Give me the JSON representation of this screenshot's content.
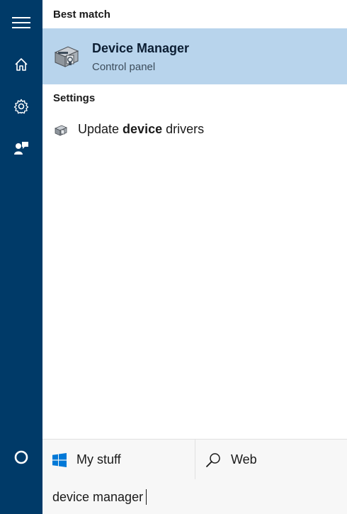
{
  "sidebar": {
    "items": [
      {
        "icon": "hamburger-menu-icon"
      },
      {
        "icon": "home-icon"
      },
      {
        "icon": "gear-icon"
      },
      {
        "icon": "feedback-icon"
      },
      {
        "icon": "cortana-circle-icon"
      }
    ]
  },
  "results": {
    "best_match_header": "Best match",
    "best_match": {
      "title": "Device Manager",
      "subtitle": "Control panel",
      "icon": "device-manager-icon"
    },
    "settings_header": "Settings",
    "settings_items": [
      {
        "prefix": "Update ",
        "highlight": "device",
        "suffix": " drivers",
        "icon": "device-manager-icon"
      }
    ]
  },
  "bottom_tabs": {
    "my_stuff": {
      "label": "My stuff",
      "icon": "windows-logo-icon"
    },
    "web": {
      "label": "Web",
      "icon": "search-icon"
    }
  },
  "search": {
    "value": "device manager"
  },
  "colors": {
    "sidebar": "#003a68",
    "highlight": "#b8d4ec",
    "windows_blue": "#0078d7"
  }
}
